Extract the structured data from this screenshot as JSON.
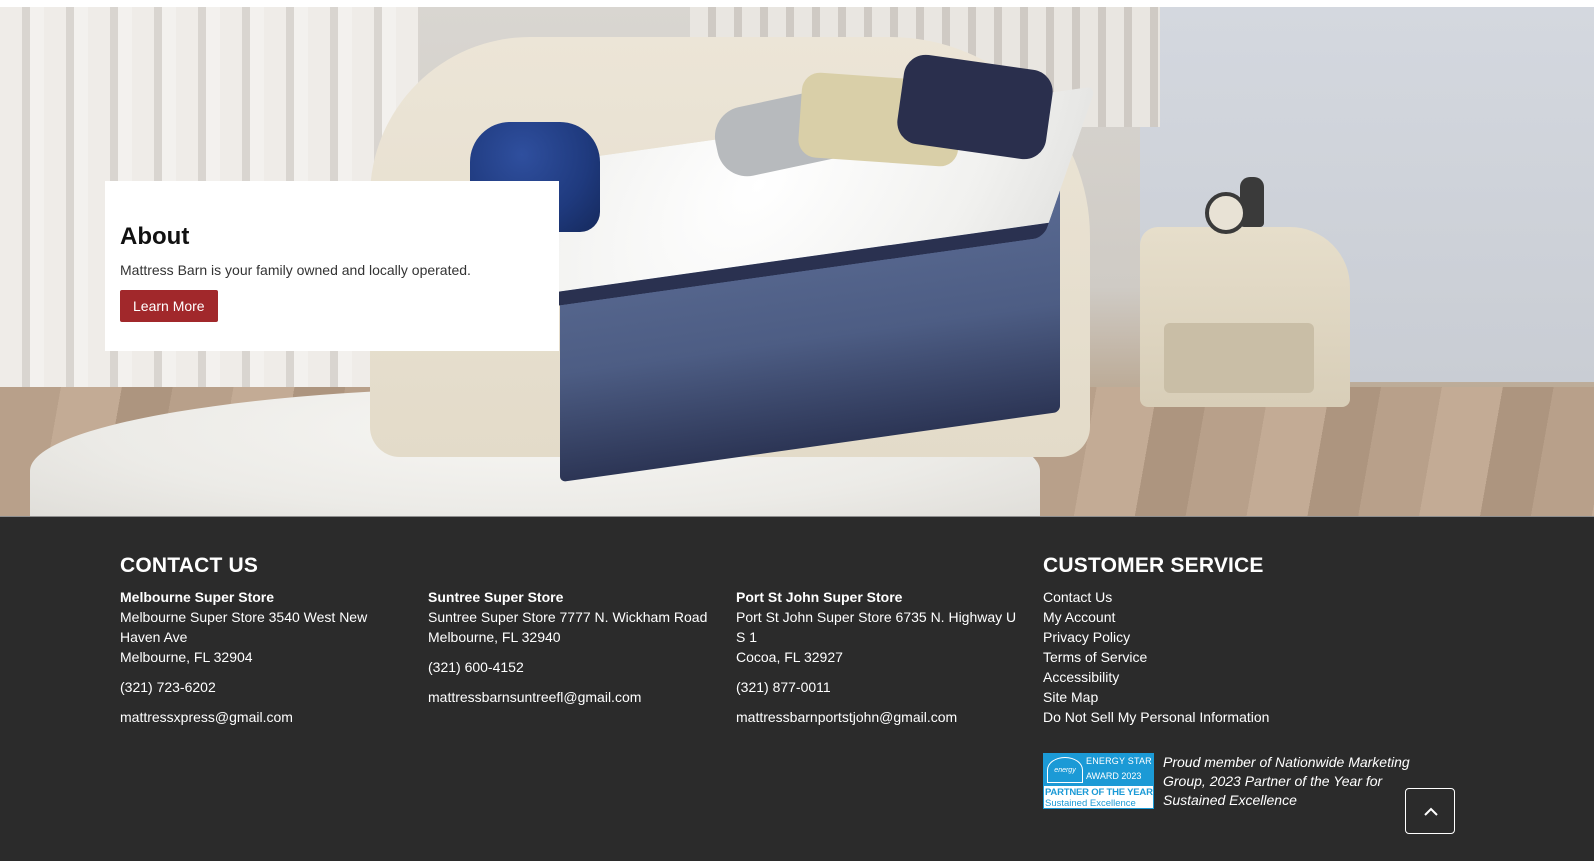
{
  "about": {
    "title": "About",
    "text": "Mattress Barn is your family owned and locally operated.",
    "button_label": "Learn More"
  },
  "contact": {
    "heading": "CONTACT US",
    "stores": [
      {
        "name": "Melbourne Super Store",
        "address_line1": "Melbourne Super Store 3540 West New Haven Ave",
        "address_line2": "Melbourne, FL 32904",
        "phone": "(321) 723-6202",
        "email": "mattressxpress@gmail.com"
      },
      {
        "name": "Suntree Super Store",
        "address_line1": "Suntree Super Store 7777 N. Wickham Road",
        "address_line2": "Melbourne, FL 32940",
        "phone": "(321) 600-4152",
        "email": "mattressbarnsuntreefl@gmail.com"
      },
      {
        "name": "Port St John Super Store",
        "address_line1": "Port St John Super Store 6735 N. Highway U S 1",
        "address_line2": "Cocoa, FL 32927",
        "phone": "(321) 877-0011",
        "email": "mattressbarnportstjohn@gmail.com"
      }
    ]
  },
  "customer_service": {
    "heading": "CUSTOMER SERVICE",
    "links": [
      "Contact Us",
      "My Account",
      "Privacy Policy",
      "Terms of Service",
      "Accessibility",
      "Site Map",
      "Do Not Sell My Personal Information"
    ]
  },
  "badge": {
    "line1": "ENERGY STAR",
    "line2": "AWARD 2023",
    "line3": "PARTNER OF THE YEAR",
    "line4": "Sustained Excellence",
    "logo_text": "energy"
  },
  "proud_text": "Proud member of Nationwide Marketing Group, 2023 Partner of the Year for Sustained Excellence",
  "icons": {
    "scroll_top": "chevron-up-icon"
  },
  "colors": {
    "button_red": "#a1282b",
    "footer_bg": "#2b2b2b",
    "energy_star_blue": "#1b9ad6"
  }
}
